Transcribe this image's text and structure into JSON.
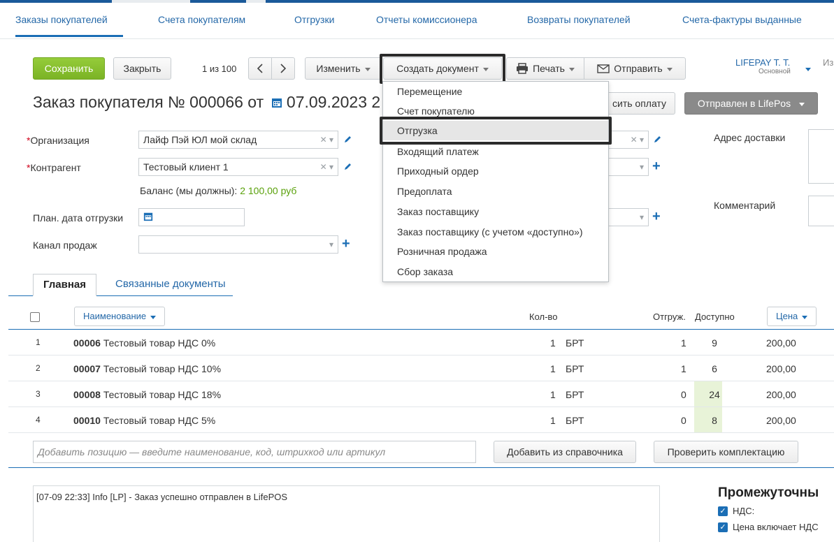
{
  "tabs": [
    "Заказы покупателей",
    "Счета покупателям",
    "Отгрузки",
    "Отчеты комиссионера",
    "Возвраты покупателей",
    "Счета-фактуры выданные"
  ],
  "toolbar": {
    "save": "Сохранить",
    "close": "Закрыть",
    "pager": "1 из 100",
    "change": "Изменить",
    "create_doc": "Создать документ",
    "print": "Печать",
    "send": "Отправить",
    "user_name": "LIFEPAY T. T.",
    "user_role": "Основной",
    "cut_text": "Из",
    "pay_btn": "сить оплату",
    "status_btn": "Отправлен в LifePos"
  },
  "title": {
    "prefix": "Заказ покупателя №  000066  от",
    "date": "07.09.2023 2"
  },
  "form": {
    "org_label": "Организация",
    "org_value": "Лайф Пэй ЮЛ мой склад",
    "contractor_label": "Контрагент",
    "contractor_value": "Тестовый клиент 1",
    "balance_label": "Баланс (мы должны):",
    "balance_value": "2 100,00 руб",
    "ship_date_label": "План. дата отгрузки",
    "channel_label": "Канал продаж",
    "address_label": "Адрес доставки",
    "comment_label": "Комментарий"
  },
  "dropdown": {
    "items": [
      "Перемещение",
      "Счет покупателю",
      "Отгрузка",
      "Входящий платеж",
      "Приходный ордер",
      "Предоплата",
      "Заказ поставщику",
      "Заказ поставщику (с учетом «доступно»)",
      "Розничная продажа",
      "Сбор заказа"
    ],
    "selected": "Отгрузка"
  },
  "subtabs": {
    "main": "Главная",
    "related": "Связанные документы"
  },
  "table": {
    "headers": {
      "name": "Наименование",
      "qty": "Кол-во",
      "shipped": "Отгруж.",
      "available": "Доступно",
      "price": "Цена"
    },
    "rows": [
      {
        "num": "1",
        "code": "00006",
        "name": "Тестовый товар НДС 0%",
        "qty": "1",
        "unit": "БРТ",
        "shipped": "1",
        "available": "9",
        "price": "200,00",
        "highlight": false
      },
      {
        "num": "2",
        "code": "00007",
        "name": "Тестовый товар НДС 10%",
        "qty": "1",
        "unit": "БРТ",
        "shipped": "1",
        "available": "6",
        "price": "200,00",
        "highlight": false
      },
      {
        "num": "3",
        "code": "00008",
        "name": "Тестовый товар НДС 18%",
        "qty": "1",
        "unit": "БРТ",
        "shipped": "0",
        "available": "24",
        "price": "200,00",
        "highlight": true
      },
      {
        "num": "4",
        "code": "00010",
        "name": "Тестовый товар НДС 5%",
        "qty": "1",
        "unit": "БРТ",
        "shipped": "0",
        "available": "8",
        "price": "200,00",
        "highlight": true
      }
    ]
  },
  "add": {
    "placeholder": "Добавить позицию — введите наименование, код, штрихкод или артикул",
    "from_catalog": "Добавить из справочника",
    "check": "Проверить комплектацию"
  },
  "log": "[07-09 22:33] Info [LP] - Заказ успешно отправлен в LifePOS",
  "summary": {
    "title": "Промежуточны",
    "vat": "НДС:",
    "price_incl_vat": "Цена включает НДС"
  },
  "colors": {
    "accent": "#1b6eb5",
    "save": "#7bb325",
    "status": "#8a8a8a"
  }
}
